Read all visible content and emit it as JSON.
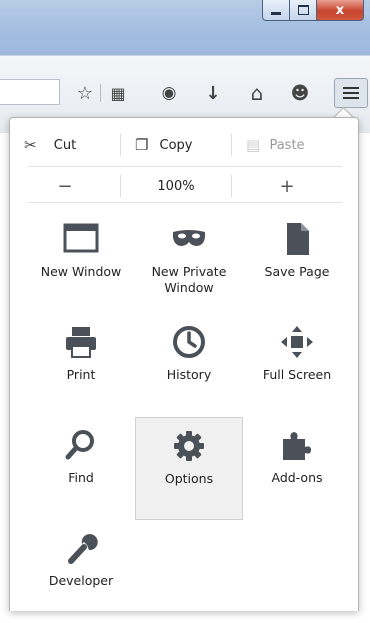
{
  "window": {
    "close_glyph": "x"
  },
  "toolbar": {
    "items": [
      {
        "name": "bookmark-star-icon",
        "glyph": "☆"
      },
      {
        "name": "bookmarks-list-icon",
        "glyph": "▦"
      },
      {
        "name": "pocket-icon",
        "glyph": "◉"
      },
      {
        "name": "downloads-icon",
        "glyph": "↓"
      },
      {
        "name": "home-icon",
        "glyph": "⌂"
      },
      {
        "name": "hello-icon",
        "glyph": "☻"
      }
    ]
  },
  "menu": {
    "edit": {
      "cut": "Cut",
      "copy": "Copy",
      "paste": "Paste"
    },
    "zoom": {
      "minus": "−",
      "level": "100%",
      "plus": "+"
    },
    "items": [
      {
        "label": "New Window",
        "icon": "new-window-icon",
        "active": false
      },
      {
        "label": "New Private Window",
        "icon": "private-mask-icon",
        "active": false
      },
      {
        "label": "Save Page",
        "icon": "save-page-icon",
        "active": false
      },
      {
        "label": "Print",
        "icon": "printer-icon",
        "active": false
      },
      {
        "label": "History",
        "icon": "history-clock-icon",
        "active": false
      },
      {
        "label": "Full Screen",
        "icon": "fullscreen-icon",
        "active": false
      },
      {
        "label": "Find",
        "icon": "magnifier-icon",
        "active": false
      },
      {
        "label": "Options",
        "icon": "gear-icon",
        "active": true
      },
      {
        "label": "Add-ons",
        "icon": "puzzle-piece-icon",
        "active": false
      },
      {
        "label": "Developer",
        "icon": "wrench-icon",
        "active": false
      }
    ]
  },
  "colors": {
    "icon": "#4b5158",
    "active_tile": "#f0f0f0"
  }
}
